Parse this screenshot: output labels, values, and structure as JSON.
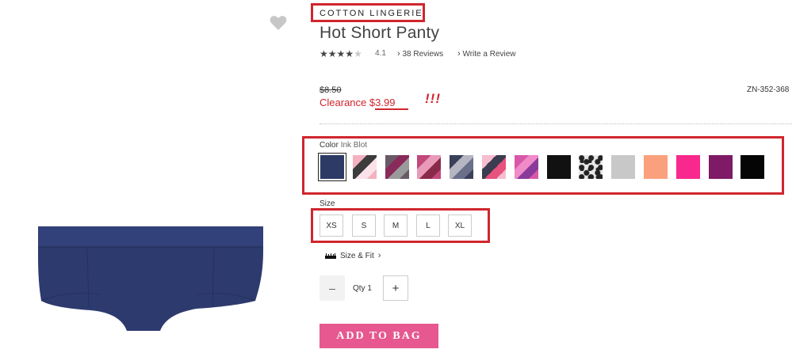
{
  "product": {
    "collection": "COTTON LINGERIE",
    "title": "Hot Short Panty",
    "rating": {
      "stars_filled": 4,
      "stars_total": 5,
      "value": "4.1",
      "reviews_link": "38 Reviews",
      "write_review": "Write a Review"
    },
    "price": {
      "original": "$8.50",
      "clearance_label": "Clearance",
      "clearance_price": "$3.99",
      "annotation": "!!!"
    },
    "sku": "ZN-352-368"
  },
  "color": {
    "label": "Color",
    "selected": "Ink Blot",
    "swatches": [
      {
        "name": "navy",
        "colors": [
          "#2d3a66"
        ]
      },
      {
        "name": "pink camo",
        "colors": [
          "#f3b2c0",
          "#3c3c3c",
          "#fbe2e8"
        ]
      },
      {
        "name": "purple lace",
        "colors": [
          "#6a5a66",
          "#8a2a5a",
          "#9a9a9a"
        ]
      },
      {
        "name": "pink floral",
        "colors": [
          "#c0487a",
          "#e89ab8",
          "#8a2a4a"
        ]
      },
      {
        "name": "grey lace stripe",
        "colors": [
          "#3a3f5a",
          "#b6b6c2",
          "#6a6f8a"
        ]
      },
      {
        "name": "geo pink",
        "colors": [
          "#f6bcd0",
          "#3c3c50",
          "#e8527e"
        ]
      },
      {
        "name": "geo purple",
        "colors": [
          "#d858a8",
          "#f08ac8",
          "#8a3a9a"
        ]
      },
      {
        "name": "black dot",
        "colors": [
          "#111111"
        ]
      },
      {
        "name": "leopard",
        "colors": [
          "#e8e8e8",
          "#222222"
        ]
      },
      {
        "name": "heather grey",
        "colors": [
          "#c8c8c8"
        ]
      },
      {
        "name": "peach",
        "colors": [
          "#fba07c"
        ]
      },
      {
        "name": "hot pink",
        "colors": [
          "#f8288c"
        ]
      },
      {
        "name": "berry",
        "colors": [
          "#7e1a66"
        ]
      },
      {
        "name": "black",
        "colors": [
          "#050505"
        ]
      }
    ]
  },
  "size": {
    "label": "Size",
    "options": [
      "XS",
      "S",
      "M",
      "L",
      "XL"
    ],
    "fit_link": "Size & Fit"
  },
  "quantity": {
    "label": "Qty",
    "value": "1",
    "minus": "–",
    "plus": "+"
  },
  "cta": {
    "add_to_bag": "ADD TO BAG"
  },
  "theme": {
    "accent": "#e6588f",
    "clearance_red": "#d0262e",
    "product_navy": "#2d3a6e"
  },
  "icons": {
    "wishlist": "heart-icon",
    "ruler": "ruler-icon",
    "chevron": "chevron-right-icon",
    "star": "star-icon"
  }
}
